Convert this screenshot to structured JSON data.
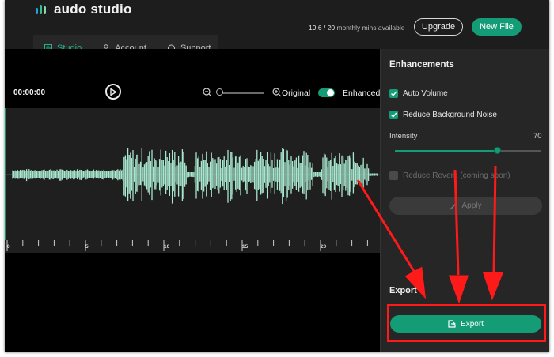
{
  "app": {
    "name": "audo studio",
    "brand_color": "#139c75"
  },
  "header": {
    "usage_value": "19.6 / 20",
    "usage_text": "monthly mins available",
    "upgrade_label": "Upgrade",
    "new_file_label": "New File"
  },
  "nav": {
    "tabs": [
      {
        "label": "Studio",
        "icon": "studio-icon",
        "active": true
      },
      {
        "label": "Account",
        "icon": "user-icon",
        "active": false
      },
      {
        "label": "Support",
        "icon": "headphones-icon",
        "active": false
      }
    ]
  },
  "editor": {
    "time": "00:00:00",
    "original_label": "Original",
    "enhanced_label": "Enhanced",
    "enhanced_toggle_on": true,
    "timeline_ticks": [
      "0",
      "5",
      "10",
      "15",
      "20"
    ]
  },
  "enhancements": {
    "title": "Enhancements",
    "auto_volume": {
      "label": "Auto Volume",
      "checked": true
    },
    "reduce_noise": {
      "label": "Reduce Background Noise",
      "checked": true
    },
    "intensity_label": "Intensity",
    "intensity_value": "70",
    "intensity_fraction": 0.7,
    "reduce_reverb": {
      "label": "Reduce Reverb (coming soon)",
      "checked": false,
      "disabled": true
    },
    "apply_label": "Apply"
  },
  "export": {
    "title": "Export",
    "button_label": "Export"
  },
  "colors": {
    "waveform": "#a8e6cf",
    "annotation": "#ff1a1a"
  }
}
